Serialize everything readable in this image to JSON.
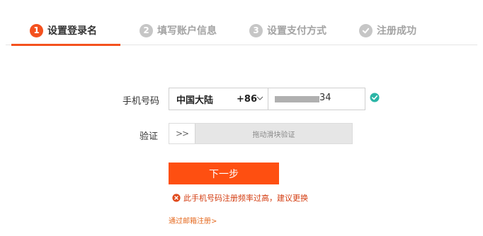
{
  "steps": [
    {
      "num": "1",
      "label": "设置登录名",
      "active": true
    },
    {
      "num": "2",
      "label": "填写账户信息",
      "active": false
    },
    {
      "num": "3",
      "label": "设置支付方式",
      "active": false
    },
    {
      "num": "",
      "label": "注册成功",
      "active": false
    }
  ],
  "form": {
    "phone_label": "手机号码",
    "region_name": "中国大陆",
    "region_code": "+86",
    "phone_tail": "34",
    "verify_label": "验证",
    "slider_knob": ">>",
    "slider_hint": "拖动滑块验证",
    "next_button": "下一步",
    "error_text": "此手机号码注册频率过高，建议更换",
    "email_link": "通过邮箱注册>"
  },
  "colors": {
    "accent": "#fe4f11",
    "success": "#2bb5a6",
    "error": "#d33c10"
  },
  "icons": [
    "check-circle-icon",
    "chevron-down-icon",
    "error-circle-icon",
    "double-arrow-icon"
  ]
}
